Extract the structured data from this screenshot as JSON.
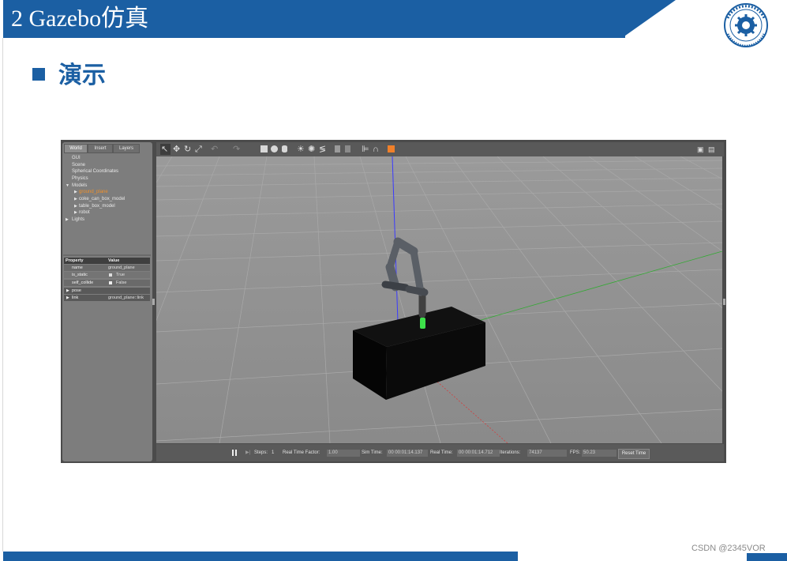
{
  "slide": {
    "title": "2 Gazebo仿真",
    "subtitle": "演示",
    "watermark": "CSDN @2345VOR",
    "colors": {
      "brand": "#1b5fa3",
      "selected": "#f0902a"
    }
  },
  "gazebo": {
    "tabs": [
      "World",
      "Insert",
      "Layers"
    ],
    "tree": {
      "gui": "GUI",
      "scene": "Scene",
      "spherical": "Spherical Coordinates",
      "physics": "Physics",
      "models": "Models",
      "ground_plane": "ground_plane",
      "coke": "coke_can_box_model",
      "table": "table_box_model",
      "robot": "robot",
      "lights": "Lights"
    },
    "properties": {
      "header_property": "Property",
      "header_value": "Value",
      "rows": [
        {
          "key": "name",
          "value": "ground_plane"
        },
        {
          "key": "is_static",
          "value": "True"
        },
        {
          "key": "self_collide",
          "value": "False"
        },
        {
          "key": "pose",
          "value": ""
        },
        {
          "key": "link",
          "value": "ground_plane::link"
        }
      ]
    },
    "bottom": {
      "steps_label": "Steps:",
      "steps_value": "1",
      "rtf_label": "Real Time Factor:",
      "rtf_value": "1.00",
      "sim_label": "Sim Time:",
      "sim_value": "00 00:01:14.137",
      "real_label": "Real Time:",
      "real_value": "00 00:01:14.712",
      "iter_label": "Iterations:",
      "iter_value": "74137",
      "fps_label": "FPS:",
      "fps_value": "50.23",
      "reset": "Reset Time"
    },
    "toolbar_icons": [
      "select-arrow-icon",
      "translate-icon",
      "rotate-icon",
      "scale-icon",
      "undo-icon",
      "redo-icon",
      "box-icon",
      "sphere-icon",
      "cylinder-icon",
      "sun-light-icon",
      "point-light-icon",
      "spot-light-icon",
      "copy-icon",
      "paste-icon",
      "align-icon",
      "snap-icon",
      "color-icon",
      "screenshot-icon",
      "log-icon"
    ]
  }
}
